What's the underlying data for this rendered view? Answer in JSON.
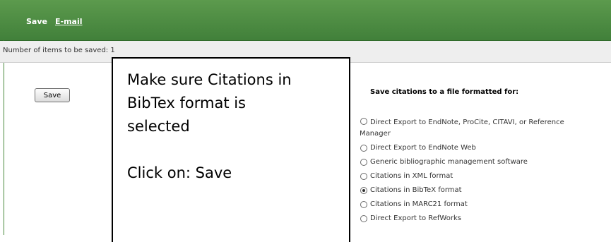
{
  "toolbar": {
    "save_label": "Save",
    "email_label": "E-mail"
  },
  "status": {
    "items_to_save": "Number of items to be saved: 1"
  },
  "form": {
    "save_button_label": "Save",
    "heading": "Save citations to a file formatted for:",
    "options": [
      {
        "label_line1": "Direct Export to EndNote, ProCite, CITAVI, or Reference",
        "label_line2": "Manager",
        "selected": false
      },
      {
        "label": "Direct Export to EndNote Web",
        "selected": false
      },
      {
        "label": "Generic bibliographic management software",
        "selected": false
      },
      {
        "label": "Citations in XML format",
        "selected": false
      },
      {
        "label": "Citations in BibTeX format",
        "selected": true
      },
      {
        "label": "Citations in MARC21 format",
        "selected": false
      },
      {
        "label": "Direct Export to RefWorks",
        "selected": false
      }
    ]
  },
  "callout": {
    "line1": "Make sure Citations in",
    "line2": "BibTex format is",
    "line3": "selected",
    "line4": "Click on: Save"
  },
  "colors": {
    "toolbar_green": "#41803a",
    "count_bar_gray": "#eeeeee"
  }
}
